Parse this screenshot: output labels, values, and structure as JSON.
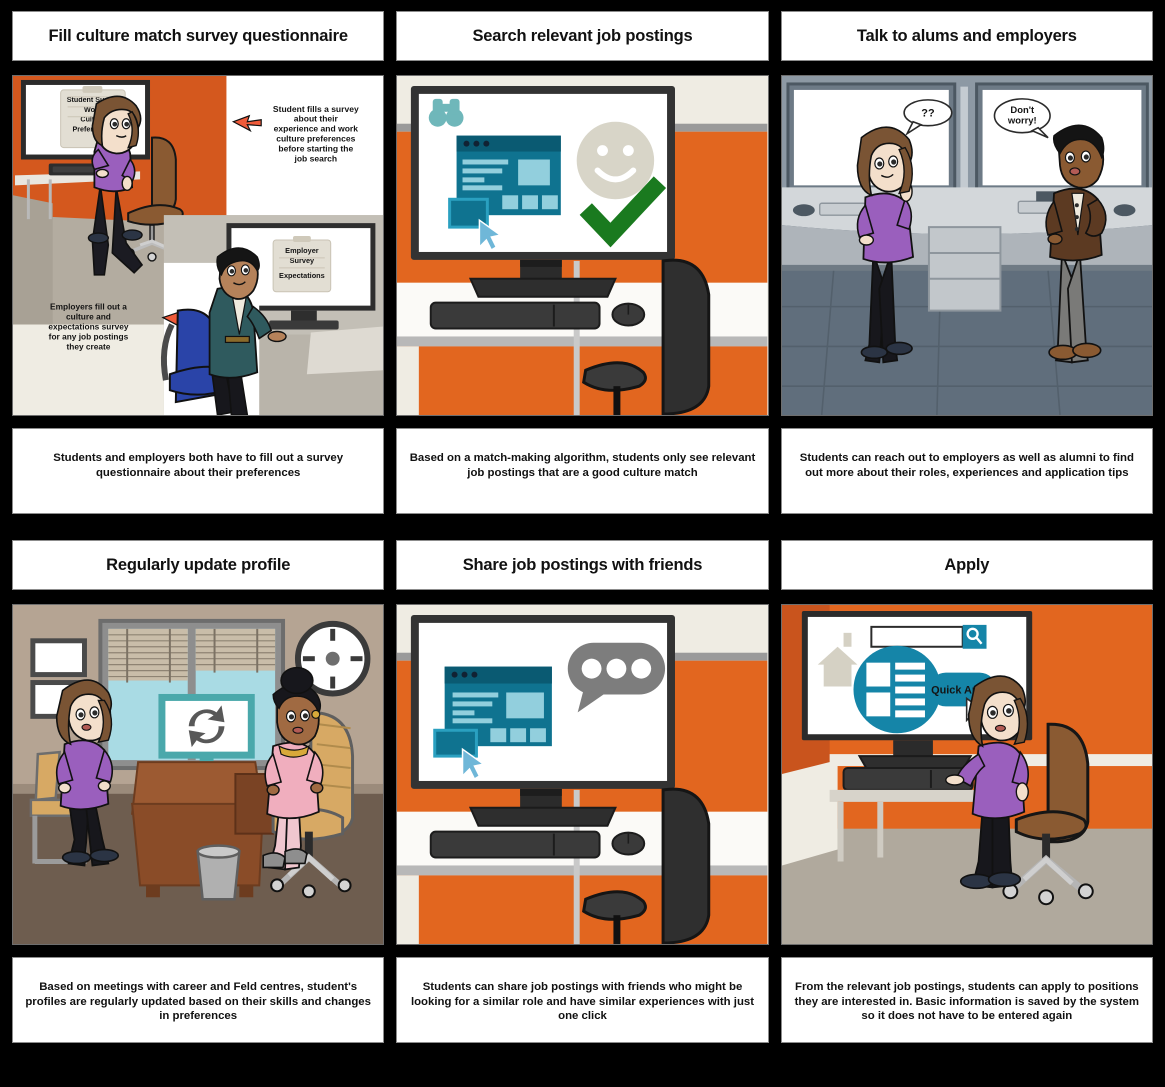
{
  "storyboard": {
    "background_color": "#000000",
    "panel_bg_color": "#ffffff",
    "accent_orange": "#e2661f",
    "accent_teal": "#1585a8",
    "check_green": "#1a7a1f",
    "panels": [
      {
        "id": "panel-1",
        "title": "Fill culture match survey questionnaire",
        "caption": "Students and employers both have to fill out a survey questionnaire about their preferences",
        "scene": {
          "name": "survey-scene",
          "student_note": "Student fills a survey about their experience and work culture preferences before starting the job search",
          "employer_note": "Employers fill out a culture and expectations survey for any job postings they create",
          "student_clipboard": [
            "Student Survey",
            "Work",
            "Culture",
            "Preferences"
          ],
          "employer_clipboard": [
            "Employer",
            "Survey",
            "Expectations"
          ]
        }
      },
      {
        "id": "panel-2",
        "title": "Search relevant job postings",
        "caption": "Based on a match-making algorithm, students only see relevant job postings that are a good culture match",
        "scene": {
          "name": "search-match-scene",
          "icons": [
            "binoculars-icon",
            "browser-window-icon",
            "smiley-face-icon",
            "green-check-icon",
            "cursor-icon"
          ]
        }
      },
      {
        "id": "panel-3",
        "title": "Talk to alums and employers",
        "caption": "Students can reach out to employers as well as alumni to find out more about their roles, experiences and application tips",
        "scene": {
          "name": "conversation-scene",
          "bubble_left": "??",
          "bubble_right": "Don't worry!"
        }
      },
      {
        "id": "panel-4",
        "title": "Regularly update profile",
        "caption": "Based on meetings with career and Feld centres, student's profiles are regularly updated based on their skills and changes in preferences",
        "scene": {
          "name": "profile-update-meeting-scene",
          "icons": [
            "refresh-sync-icon",
            "wall-clock-icon",
            "window-blinds-icon",
            "waste-bin-icon"
          ]
        }
      },
      {
        "id": "panel-5",
        "title": "Share job postings with friends",
        "caption": "Students can share job postings with friends who might be looking for a similar role and have similar experiences with just one click",
        "scene": {
          "name": "share-posting-scene",
          "icons": [
            "browser-window-icon",
            "chat-bubble-icon",
            "cursor-icon"
          ]
        }
      },
      {
        "id": "panel-6",
        "title": "Apply",
        "caption": "From the relevant job postings, students can apply to positions they are interested in. Basic information is saved by the system so it does not have to be entered again",
        "scene": {
          "name": "quick-apply-scene",
          "button_label": "Quick Apply",
          "search_placeholder": "",
          "icons": [
            "home-icon",
            "search-icon",
            "resume-document-icon",
            "cursor-icon"
          ]
        }
      }
    ]
  }
}
